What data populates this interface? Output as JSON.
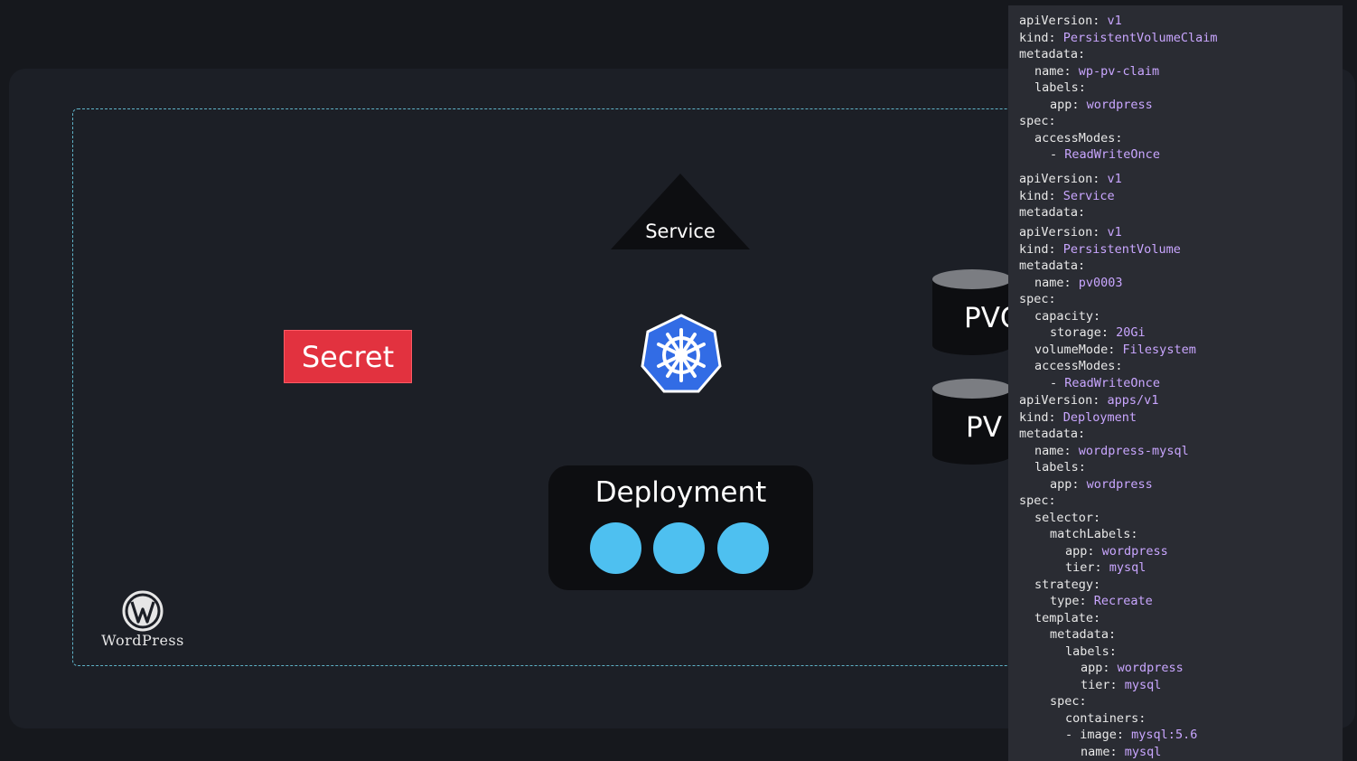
{
  "diagram": {
    "service_label": "Service",
    "secret_label": "Secret",
    "deployment_label": "Deployment",
    "pvc_label": "PVC",
    "pv_label": "PV",
    "wordpress_logo_text": "WordPress",
    "pod_count": 3
  },
  "colors": {
    "secret": "#e2323f",
    "pod": "#4ec0f0",
    "kubernetes": "#326ce5",
    "cluster_border": "#5fb3c8",
    "yaml_value": "#c9a6ff"
  },
  "yaml_lines": [
    {
      "indent": 0,
      "key": "apiVersion:",
      "value": "v1"
    },
    {
      "indent": 0,
      "key": "kind:",
      "value": "PersistentVolumeClaim"
    },
    {
      "indent": 0,
      "key": "metadata:",
      "value": ""
    },
    {
      "indent": 1,
      "key": "name:",
      "value": "wp-pv-claim"
    },
    {
      "indent": 1,
      "key": "labels:",
      "value": ""
    },
    {
      "indent": 2,
      "key": "app:",
      "value": "wordpress"
    },
    {
      "indent": 0,
      "key": "spec:",
      "value": ""
    },
    {
      "indent": 1,
      "key": "accessModes:",
      "value": ""
    },
    {
      "indent": 2,
      "key": "-",
      "value": "ReadWriteOnce"
    },
    {
      "indent": 0,
      "key": "apiVersion:",
      "value": "v1"
    },
    {
      "indent": 0,
      "key": "kind:",
      "value": "Service"
    },
    {
      "indent": 0,
      "key": "metadata:",
      "value": ""
    },
    {
      "indent": 0,
      "key": "apiVersion:",
      "value": "v1"
    },
    {
      "indent": 0,
      "key": "kind:",
      "value": "PersistentVolume"
    },
    {
      "indent": 0,
      "key": "metadata:",
      "value": ""
    },
    {
      "indent": 1,
      "key": "name:",
      "value": "pv0003"
    },
    {
      "indent": 0,
      "key": "spec:",
      "value": ""
    },
    {
      "indent": 1,
      "key": "capacity:",
      "value": ""
    },
    {
      "indent": 2,
      "key": "storage:",
      "value": "20Gi"
    },
    {
      "indent": 1,
      "key": "volumeMode:",
      "value": "Filesystem"
    },
    {
      "indent": 1,
      "key": "accessModes:",
      "value": ""
    },
    {
      "indent": 2,
      "key": "-",
      "value": "ReadWriteOnce"
    },
    {
      "indent": 0,
      "key": "apiVersion:",
      "value": "apps/v1"
    },
    {
      "indent": 0,
      "key": "kind:",
      "value": "Deployment"
    },
    {
      "indent": 0,
      "key": "metadata:",
      "value": ""
    },
    {
      "indent": 1,
      "key": "name:",
      "value": "wordpress-mysql"
    },
    {
      "indent": 1,
      "key": "labels:",
      "value": ""
    },
    {
      "indent": 2,
      "key": "app:",
      "value": "wordpress"
    },
    {
      "indent": 0,
      "key": "spec:",
      "value": ""
    },
    {
      "indent": 1,
      "key": "selector:",
      "value": ""
    },
    {
      "indent": 2,
      "key": "matchLabels:",
      "value": ""
    },
    {
      "indent": 3,
      "key": "app:",
      "value": "wordpress"
    },
    {
      "indent": 3,
      "key": "tier:",
      "value": "mysql"
    },
    {
      "indent": 1,
      "key": "strategy:",
      "value": ""
    },
    {
      "indent": 2,
      "key": "type:",
      "value": "Recreate"
    },
    {
      "indent": 1,
      "key": "template:",
      "value": ""
    },
    {
      "indent": 2,
      "key": "metadata:",
      "value": ""
    },
    {
      "indent": 3,
      "key": "labels:",
      "value": ""
    },
    {
      "indent": 4,
      "key": "app:",
      "value": "wordpress"
    },
    {
      "indent": 4,
      "key": "tier:",
      "value": "mysql"
    },
    {
      "indent": 2,
      "key": "spec:",
      "value": ""
    },
    {
      "indent": 3,
      "key": "containers:",
      "value": ""
    },
    {
      "indent": 3,
      "key": "- image:",
      "value": "mysql:5.6"
    },
    {
      "indent": 4,
      "key": "name:",
      "value": "mysql"
    }
  ]
}
